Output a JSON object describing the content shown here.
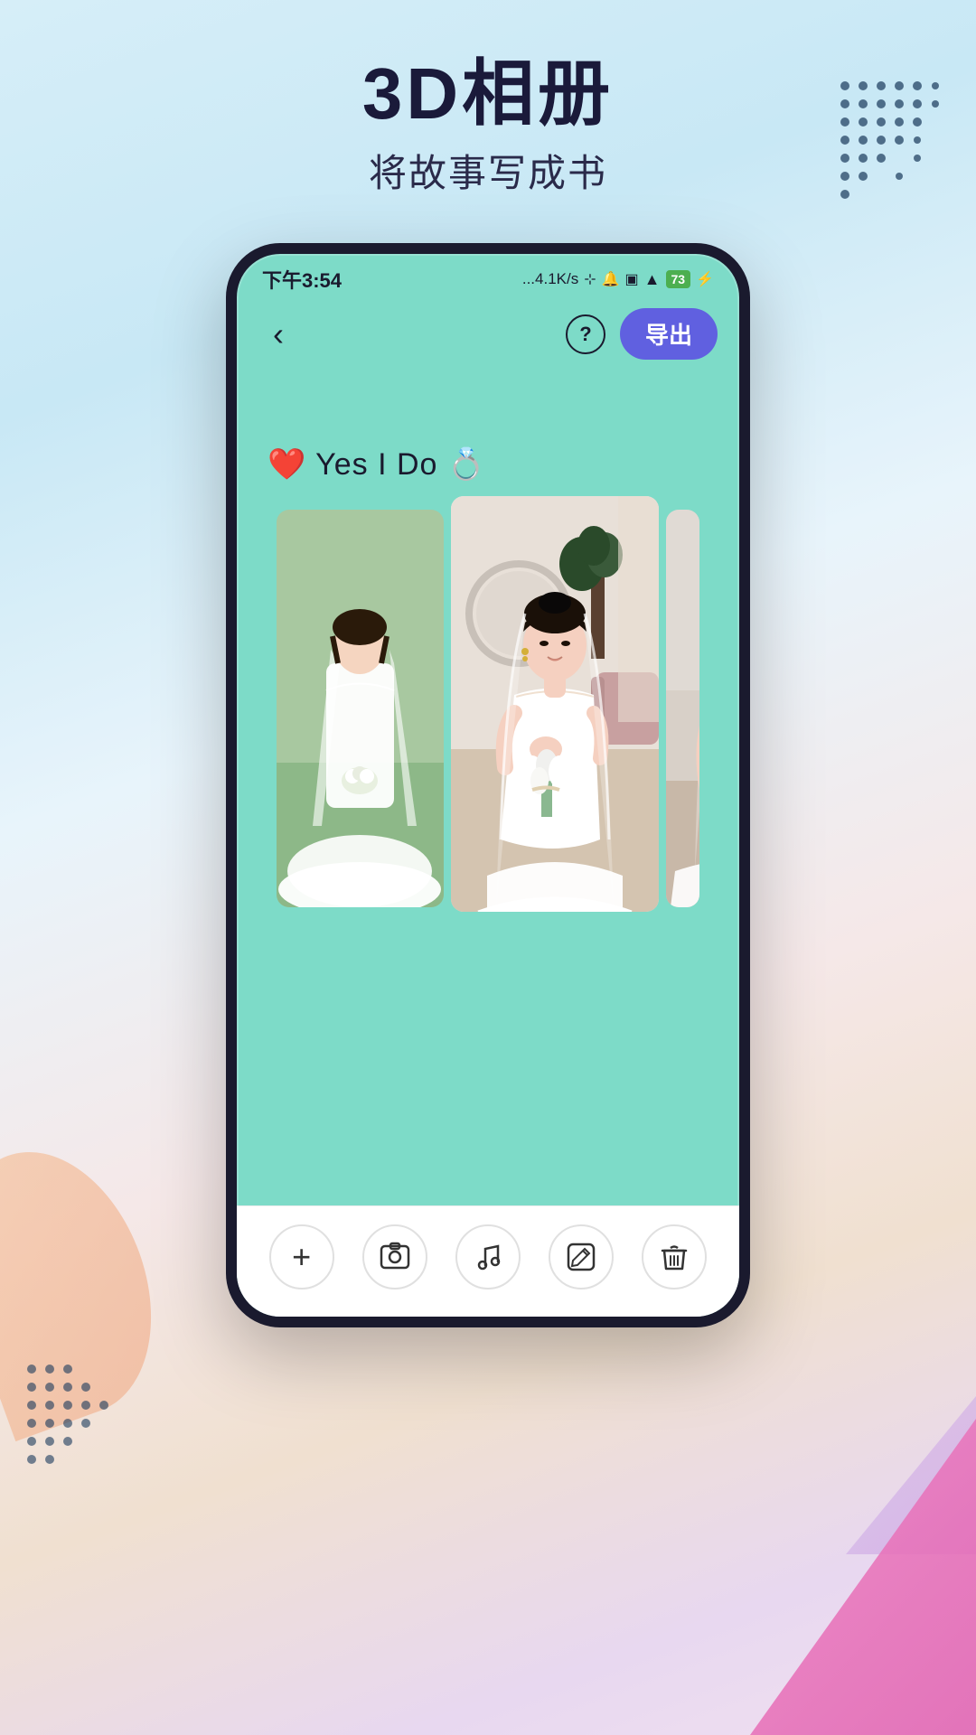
{
  "header": {
    "title": "3D相册",
    "subtitle": "将故事写成书"
  },
  "status_bar": {
    "time": "下午3:54",
    "network": "...4.1K/s",
    "battery": "73"
  },
  "app_bar": {
    "back_label": "‹",
    "help_label": "?",
    "export_label": "导出"
  },
  "album": {
    "title": "❤️ Yes I Do 💍"
  },
  "toolbar": {
    "add_label": "+",
    "photo_label": "🖼",
    "music_label": "🎵",
    "edit_label": "✏",
    "delete_label": "🗑"
  },
  "dots": {
    "color": "#1a3a5c"
  },
  "colors": {
    "phone_bg": "#7ddbc8",
    "export_btn": "#6060e0",
    "title_dark": "#1a1a3a"
  }
}
